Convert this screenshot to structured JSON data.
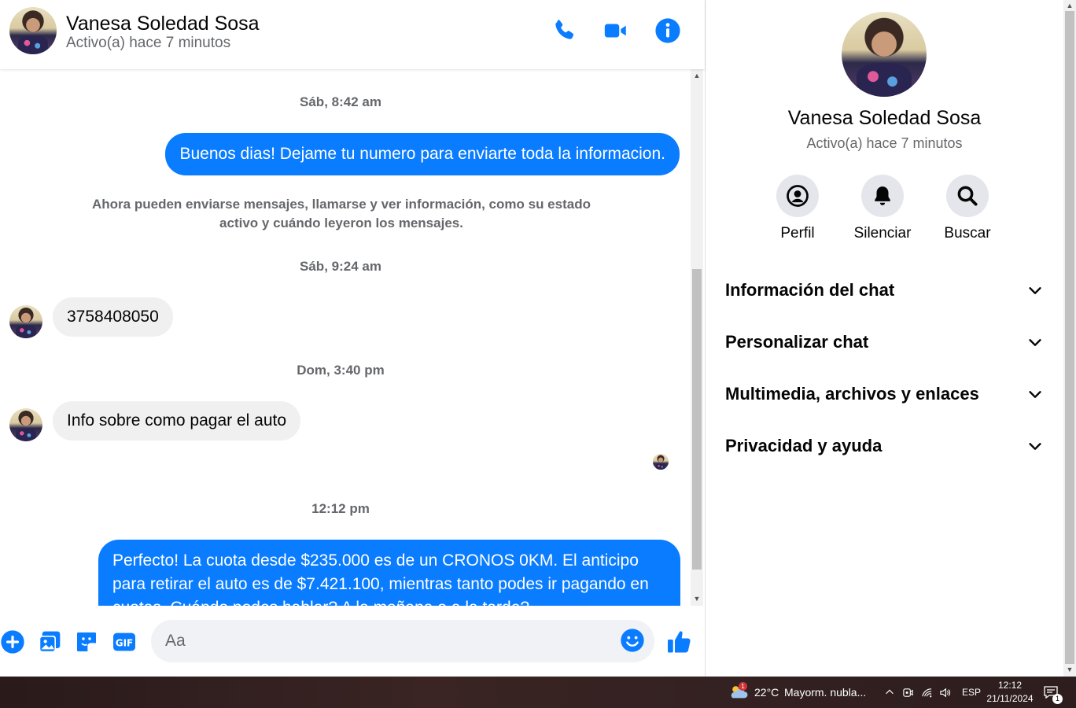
{
  "header": {
    "name": "Vanesa Soledad Sosa",
    "status": "Activo(a) hace 7 minutos"
  },
  "messages": {
    "stamp1": "Sáb, 8:42 am",
    "out1": "Buenos dias! Dejame tu numero para enviarte toda la informacion.",
    "system_note": "Ahora pueden enviarse mensajes, llamarse y ver información, como su estado activo y cuándo leyeron los mensajes.",
    "stamp2": "Sáb, 9:24 am",
    "in1": "3758408050",
    "stamp3": "Dom, 3:40 pm",
    "in2": "Info sobre como pagar el auto",
    "stamp4": "12:12 pm",
    "out2": "Perfecto! La cuota desde $235.000 es de un CRONOS 0KM. El anticipo para retirar el auto es de $7.421.100, mientras tanto podes ir pagando en cuotas. Cuándo podes hablar? A la mañana o a la tarde?"
  },
  "composer": {
    "placeholder": "Aa"
  },
  "side": {
    "name": "Vanesa Soledad Sosa",
    "status": "Activo(a) hace 7 minutos",
    "actions": [
      {
        "label": "Perfil",
        "icon": "profile-icon"
      },
      {
        "label": "Silenciar",
        "icon": "bell-icon"
      },
      {
        "label": "Buscar",
        "icon": "search-icon"
      }
    ],
    "sections": [
      "Información del chat",
      "Personalizar chat",
      "Multimedia, archivos y enlaces",
      "Privacidad y ayuda"
    ]
  },
  "taskbar": {
    "weather_badge": "1",
    "temperature": "22°C",
    "weather_text": "Mayorm. nubla...",
    "language": "ESP",
    "time": "12:12",
    "date": "21/11/2024",
    "notification_count": "1"
  },
  "colors": {
    "accent": "#0a7cff",
    "bubble_in": "#f0f0f0",
    "muted_text": "#65676b"
  }
}
